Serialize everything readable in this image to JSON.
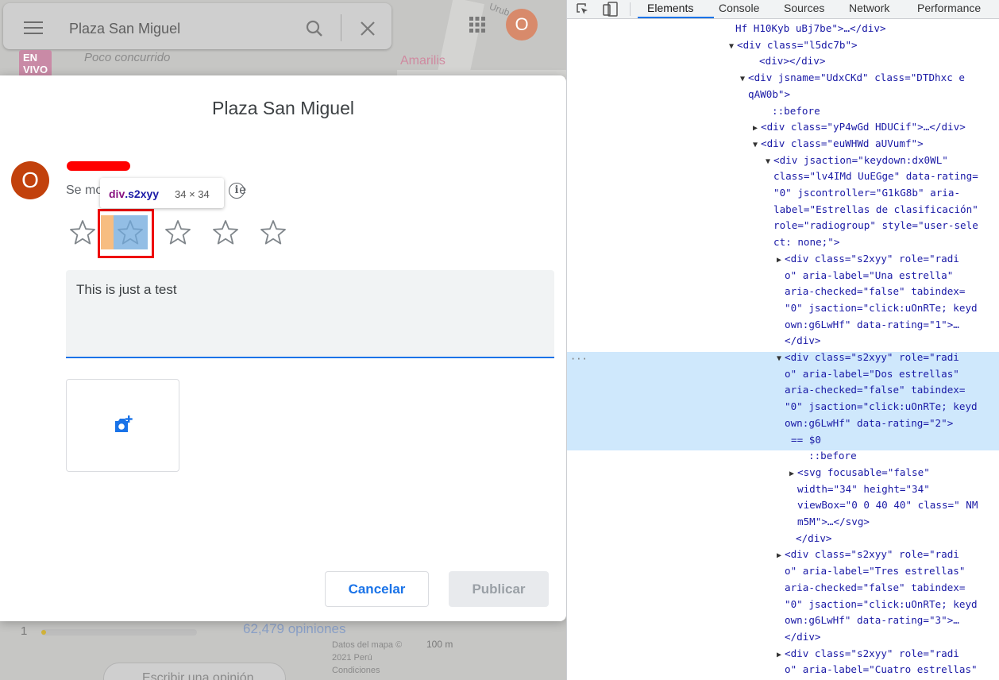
{
  "maps": {
    "search_query": "Plaza San Miguel",
    "live_badge": "EN VIVO",
    "live_status": "Poco concurrido",
    "user_initial": "O",
    "nearby_place": "Amarilis",
    "street_label": "Urub",
    "bottom": {
      "rating_one": "1",
      "reviews": "62,479 opiniones",
      "map_data": "Datos del mapa © 2021 Perú Condiciones",
      "scale": "100 m",
      "write_review": "Escribir una opinión"
    }
  },
  "dialog": {
    "title": "Plaza San Miguel",
    "user_initial": "O",
    "subtitle": "Se mo",
    "subtitle_tail": "e",
    "info_glyph": "i",
    "stars": [
      {
        "label": "Una estrella"
      },
      {
        "label": "Dos estrellas"
      },
      {
        "label": "Tres estrellas"
      },
      {
        "label": "Cuatro estrellas"
      },
      {
        "label": "Cinco estrellas"
      }
    ],
    "review_text": "This is just a test",
    "cancel_label": "Cancelar",
    "publish_label": "Publicar",
    "tooltip_name": "div.s2xyy",
    "tooltip_tag": "div",
    "tooltip_class": ".s2xyy",
    "tooltip_size": "34 × 34"
  },
  "devtools": {
    "tabs": [
      "Elements",
      "Console",
      "Sources",
      "Network",
      "Performance"
    ],
    "active_tab": "Elements",
    "lines": [
      "Hf H10Kyb uBj7be\">…</div>",
      "<div class=\"l5dc7b\">",
      "<div></div>",
      "<div jsname=\"UdxCKd\" class=\"DTDhxc e",
      "qAW0b\">",
      "::before",
      "<div class=\"yP4wGd HDUCif\">…</div>",
      "<div class=\"euWHWd aUVumf\">",
      "<div jsaction=\"keydown:dx0WL\"",
      "class=\"lv4IMd UuEGge\" data-rating=",
      "\"0\" jscontroller=\"G1kG8b\" aria-",
      "label=\"Estrellas de clasificación\"",
      "role=\"radiogroup\" style=\"user-sele",
      "ct: none;\">",
      "<div class=\"s2xyy\" role=\"radi",
      "o\" aria-label=\"Una estrella\"",
      "aria-checked=\"false\" tabindex=",
      "\"0\" jsaction=\"click:uOnRTe; keyd",
      "own:g6LwHf\" data-rating=\"1\">…",
      "</div>",
      "<div class=\"s2xyy\" role=\"radi",
      "o\" aria-label=\"Dos estrellas\"",
      "aria-checked=\"false\" tabindex=",
      "\"0\" jsaction=\"click:uOnRTe; keyd",
      "own:g6LwHf\" data-rating=\"2\">",
      "== $0",
      "::before",
      "<svg focusable=\"false\"",
      "width=\"34\" height=\"34\"",
      "viewBox=\"0 0 40 40\" class=\" NM",
      "m5M\">…</svg>",
      "</div>",
      "<div class=\"s2xyy\" role=\"radi",
      "o\" aria-label=\"Tres estrellas\"",
      "aria-checked=\"false\" tabindex=",
      "\"0\" jsaction=\"click:uOnRTe; keyd",
      "own:g6LwHf\" data-rating=\"3\">…",
      "</div>",
      "<div class=\"s2xyy\" role=\"radi",
      "o\" aria-label=\"Cuatro estrellas\""
    ]
  }
}
